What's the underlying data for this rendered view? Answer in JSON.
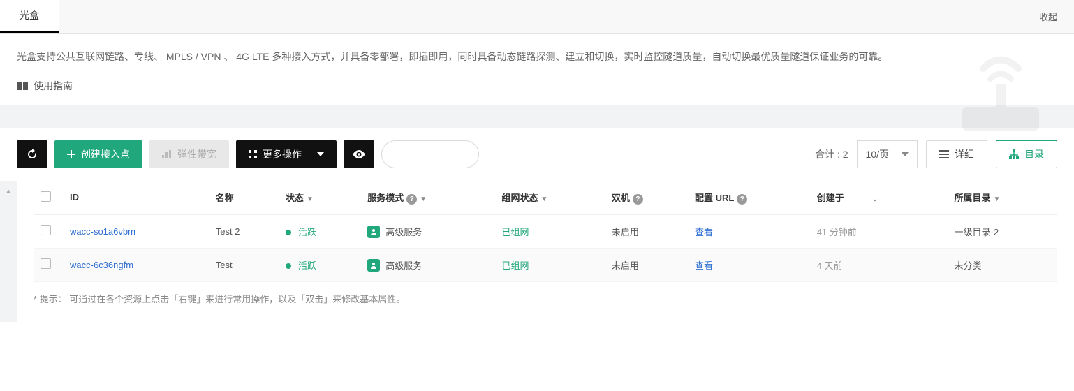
{
  "tabs": {
    "active": "光盒",
    "collapse": "收起"
  },
  "banner": {
    "desc": "光盒支持公共互联网链路、专线、 MPLS / VPN 、 4G LTE 多种接入方式，并具备零部署，即插即用，同时具备动态链路探测、建立和切换，实时监控隧道质量，自动切换最优质量隧道保证业务的可靠。",
    "guide": "使用指南"
  },
  "toolbar": {
    "create": "创建接入点",
    "elastic": "弹性带宽",
    "more": "更多操作",
    "total_label": "合计 :",
    "total_value": "2",
    "pagesize": "10/页",
    "detail": "详细",
    "catalog": "目录"
  },
  "columns": {
    "id": "ID",
    "name": "名称",
    "status": "状态",
    "service": "服务模式",
    "network": "组网状态",
    "dual": "双机",
    "cfgurl": "配置 URL",
    "created": "创建于",
    "dir": "所属目录"
  },
  "rows": [
    {
      "id": "wacc-so1a6vbm",
      "name": "Test 2",
      "status": "活跃",
      "service": "高级服务",
      "network": "已组网",
      "dual": "未启用",
      "cfgurl": "查看",
      "created": "41 分钟前",
      "dir": "一级目录-2"
    },
    {
      "id": "wacc-6c36ngfm",
      "name": "Test",
      "status": "活跃",
      "service": "高级服务",
      "network": "已组网",
      "dual": "未启用",
      "cfgurl": "查看",
      "created": "4 天前",
      "dir": "未分类"
    }
  ],
  "hint": "* 提示： 可通过在各个资源上点击「右键」来进行常用操作，以及「双击」来修改基本属性。"
}
